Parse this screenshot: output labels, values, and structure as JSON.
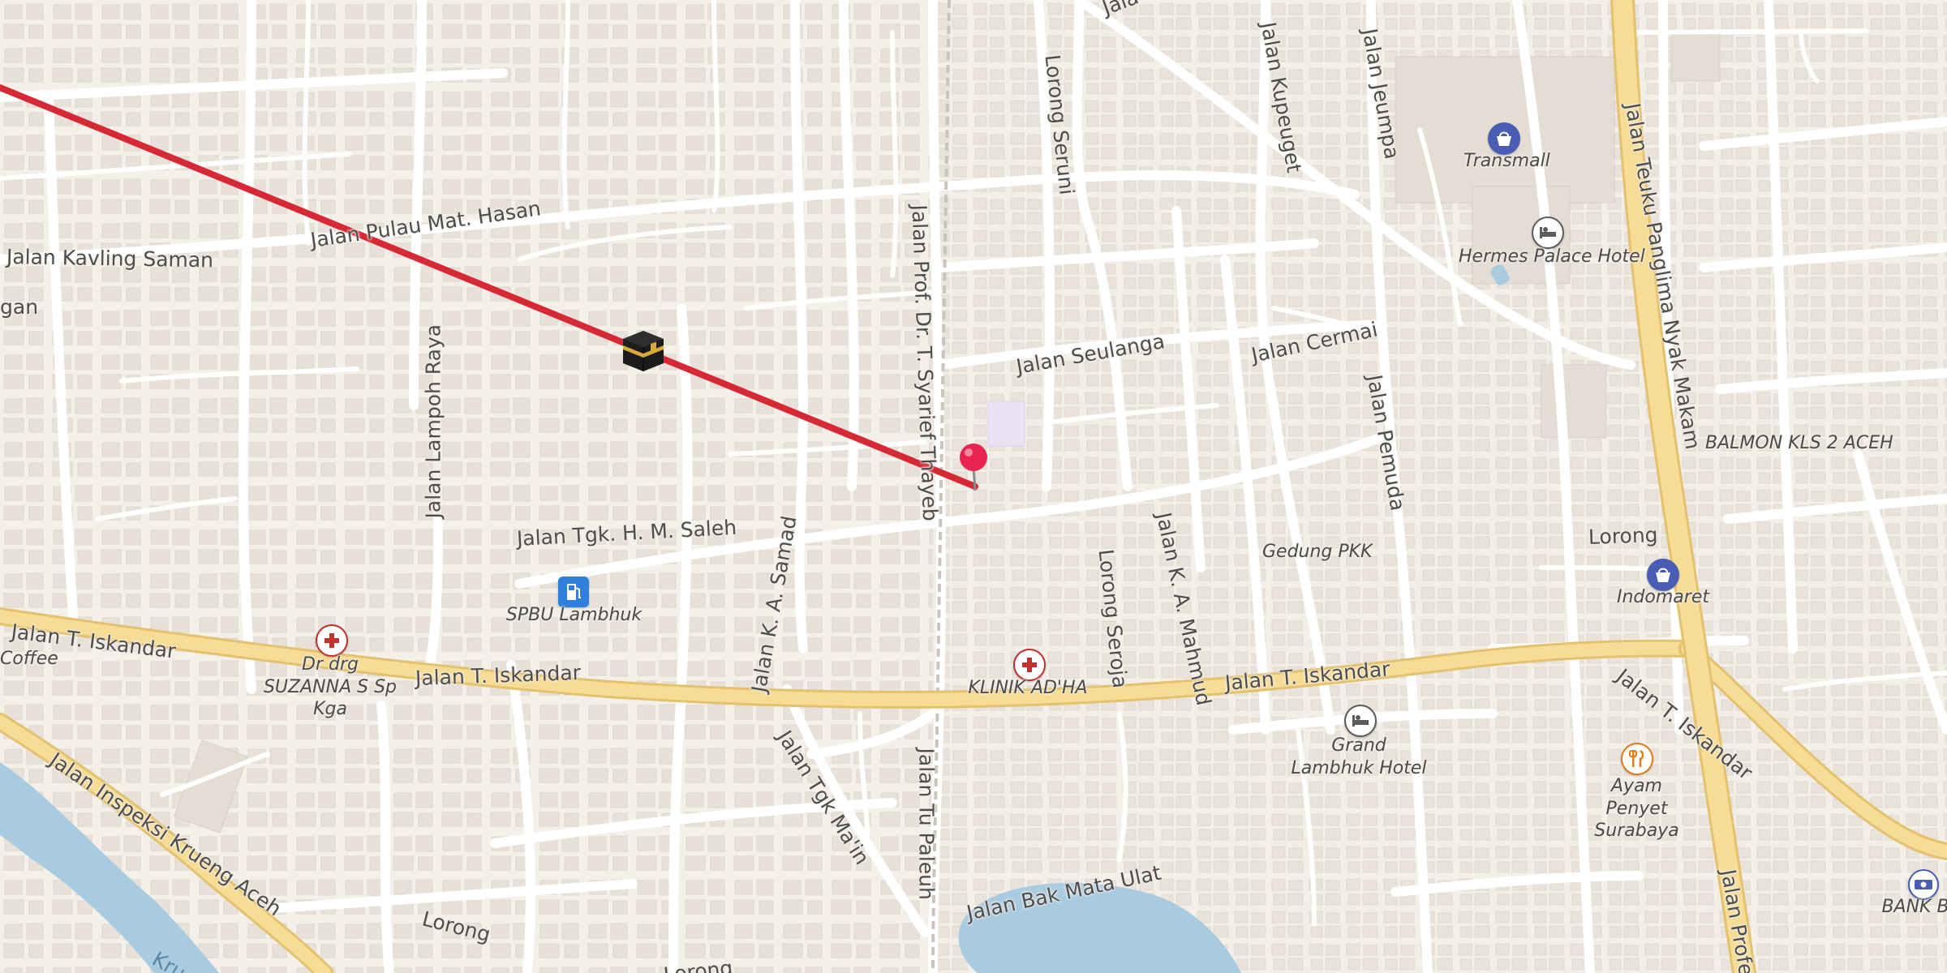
{
  "map": {
    "colors": {
      "land": "#f3efe9",
      "building": "#e8e2da",
      "minor_road": "#ffffff",
      "main_road_fill": "#f7dc95",
      "main_road_casing": "#e3c16e",
      "water": "#a9cbe0",
      "route_line": "#d62835",
      "pin": "#e8234f",
      "poi_health": "#c3302f",
      "poi_shop": "#4a5db5",
      "poi_fuel": "#2f7fdb",
      "poi_food": "#e07b18",
      "poi_hotel": "#5c5c5c",
      "poi_bank": "#4a5db5"
    },
    "street_labels": [
      "Jalan Pulau Mat. Hasan",
      "Jalan Kavling Saman",
      "gan",
      "Jalan Lampoh Raya",
      "Jalan Tgk. H. M. Saleh",
      "Jalan T. Iskandar",
      "Jalan T. Iskandar",
      "Jalan T. Iskandar",
      "Jalan T. Iskandar",
      "Jalan Inspeksi Krueng Aceh",
      "Jalan K. A. Samad",
      "Jalan Tgk Ma'in",
      "Jalan Prof. Dr. T. Syarief Thayeb",
      "Jalan Tu Paleuh",
      "Jalan Bak Mata Ulat",
      "Lorong",
      "Lorong",
      "Lorong",
      "Lorong Seruni",
      "Jalan Kupeuget",
      "Jalan Jeumpa",
      "Jalan Seulanga",
      "Jalan Cermai",
      "Jalan Pemuda",
      "Lorong Seroja",
      "Jalan K. A. Mahmud",
      "Jalan Teuku Panglima Nyak Makam",
      "Jalan Profes",
      "Jala",
      "Kru"
    ],
    "poi_labels": [
      {
        "text": "Transmall",
        "icon": "shopping-basket"
      },
      {
        "text": "Hermes Palace Hotel",
        "icon": "bed"
      },
      {
        "text": "BALMON KLS 2 ACEH",
        "icon": ""
      },
      {
        "text": "Indomaret",
        "icon": "shopping-basket"
      },
      {
        "text": "Gedung PKK",
        "icon": ""
      },
      {
        "text": "Grand Lambhuk Hotel",
        "icon": "bed"
      },
      {
        "text": "Ayam Penyet Surabaya",
        "icon": "fork-knife"
      },
      {
        "text": "KLINIK AD'HA",
        "icon": "medical-cross"
      },
      {
        "text": "Dr drg SUZANNA S Sp Kga",
        "icon": "medical-cross"
      },
      {
        "text": "SPBU Lambhuk",
        "icon": "fuel-pump"
      },
      {
        "text": "Coffee",
        "icon": ""
      },
      {
        "text": "BANK B",
        "icon": "banknote"
      }
    ],
    "markers": {
      "kaaba": "kaaba-icon",
      "location_pin": "map-pin-icon"
    }
  }
}
